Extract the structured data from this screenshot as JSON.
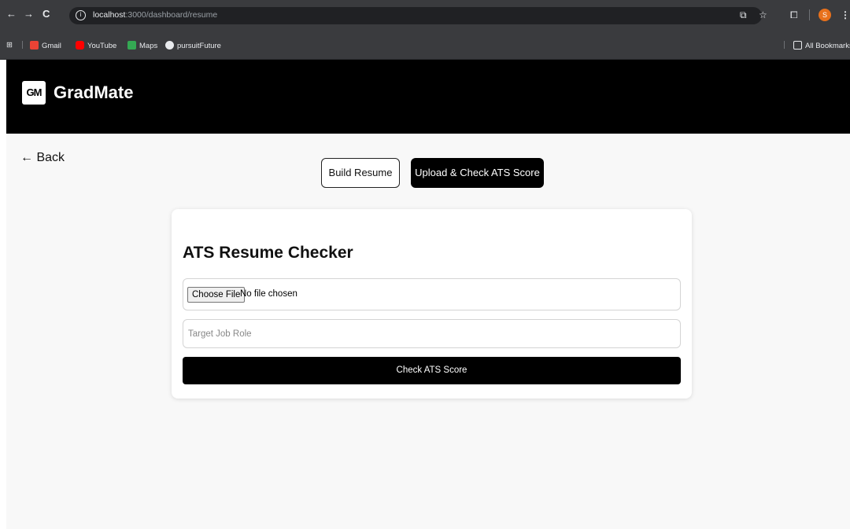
{
  "browser": {
    "url_host": "localhost",
    "url_path": ":3000/dashboard/resume",
    "nav": {
      "back": "←",
      "forward": "→",
      "reload": "C"
    },
    "profile_initial": "S",
    "bookmarks": [
      {
        "label": "Gmail",
        "color": "#ea4335"
      },
      {
        "label": "YouTube",
        "color": "#ff0000"
      },
      {
        "label": "Maps",
        "color": "#34a853"
      },
      {
        "label": "pursuitFuture",
        "color": "#e8eaed"
      }
    ],
    "all_bookmarks": "All Bookmarks"
  },
  "header": {
    "logo_text": "GM",
    "brand": "GradMate"
  },
  "page": {
    "back_label": "← Back",
    "tabs": {
      "build": "Build Resume",
      "upload": "Upload & Check ATS Score"
    },
    "card": {
      "title": "ATS Resume Checker",
      "file_button": "Choose File",
      "file_status": "No file chosen",
      "role_placeholder": "Target Job Role",
      "submit": "Check ATS Score"
    }
  }
}
